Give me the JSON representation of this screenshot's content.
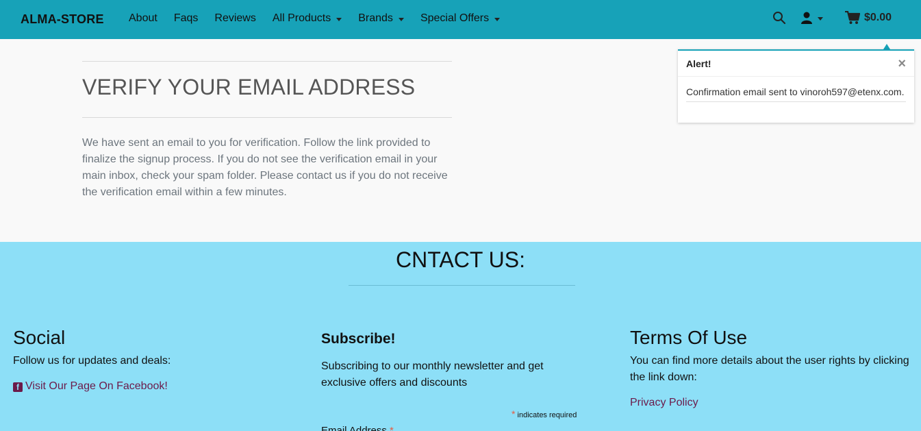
{
  "navbar": {
    "brand": "ALMA-STORE",
    "items": [
      {
        "label": "About"
      },
      {
        "label": "Faqs"
      },
      {
        "label": "Reviews"
      },
      {
        "label": "All Products"
      },
      {
        "label": "Brands"
      },
      {
        "label": "Special Offers"
      }
    ],
    "cart_total": "$0.00",
    "icons": [
      "search-icon",
      "user-icon",
      "cart-icon"
    ]
  },
  "main": {
    "heading": "VERIFY YOUR EMAIL ADDRESS",
    "body": "We have sent an email to you for verification. Follow the link provided to finalize the signup process. If you do not see the verification email in your main inbox, check your spam folder. Please contact us if you do not receive the verification email within a few minutes."
  },
  "alert": {
    "title": "Alert!",
    "close": "×",
    "message": "Confirmation email sent to vinoroh597@etenx.com."
  },
  "footer": {
    "title": "CNTACT US:",
    "social": {
      "heading": "Social",
      "text": "Follow us for updates and deals:",
      "link": "Visit Our Page On Facebook!"
    },
    "subscribe": {
      "heading": "Subscribe!",
      "text": "Subscribing to our monthly newsletter and get exclusive offers and discounts",
      "required_note": "indicates required",
      "email_label": "Email Address"
    },
    "terms": {
      "heading": "Terms Of Use",
      "text": "You can find more details about the user rights by clicking the link down:",
      "link": "Privacy Policy"
    }
  },
  "colors": {
    "navbar": "#17a2b8",
    "footer": "#8ddff7",
    "link": "#6b1a4a"
  }
}
